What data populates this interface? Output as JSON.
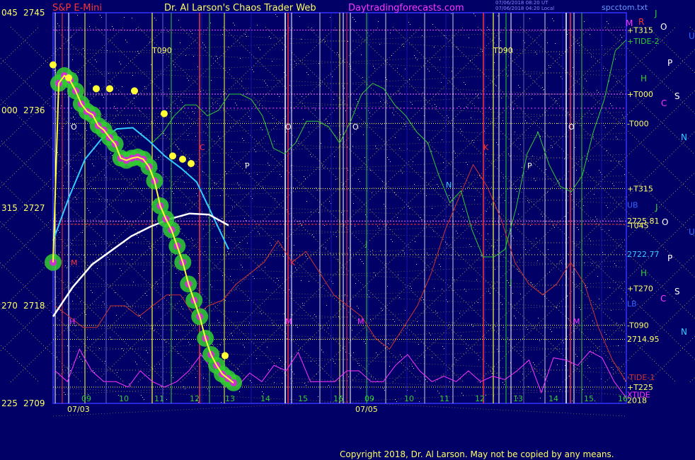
{
  "header": {
    "symbol": "S&P E-Mini",
    "title": "Dr. Al Larson's Chaos Trader Web",
    "site": "Daytradingforecasts.com",
    "timestamp_1": "07/06/2018 08:20 UT",
    "timestamp_2": "07/06/2018 04:20 Local",
    "file": "spcctom.txt"
  },
  "footer": {
    "copyright": "Copyright 2018, Dr. Al Larson. May not be copied by any means."
  },
  "colors": {
    "background": "#000066",
    "price_glow": "#33cc33",
    "price_dots": "#cc33cc",
    "price_line": "#ffff33",
    "cyan_curve": "#33ccff",
    "white_curve": "#ffffff",
    "tide2": "#33cc33",
    "tide1": "#cc3333",
    "xtide": "#ff33ff",
    "grid": "#ffff44",
    "marker_red": "#ff3333",
    "marker_green": "#33cc33"
  },
  "chart_data": {
    "type": "line",
    "y_left_labels": [
      {
        "mod": "045",
        "price": "2745"
      },
      {
        "mod": "000",
        "price": "2736"
      },
      {
        "mod": "315",
        "price": "2727"
      },
      {
        "mod": "270",
        "price": "2718"
      },
      {
        "mod": "225",
        "price": "2709"
      }
    ],
    "ylim": [
      2709,
      2745
    ],
    "x_ticks": [
      "09",
      "10",
      "11",
      "12",
      "13",
      "14",
      "15",
      "16",
      "09",
      "10",
      "11",
      "12",
      "13",
      "14",
      "15",
      "16"
    ],
    "date_labels": [
      "07/03",
      "07/05"
    ],
    "right_labels": [
      {
        "text": "+T315",
        "price": 2743.4,
        "color": "#ffff66"
      },
      {
        "text": "+TIDE-2",
        "price": 2742.4,
        "color": "#33cc33"
      },
      {
        "text": "+T000",
        "price": 2737.5,
        "color": "#ffff66"
      },
      {
        "text": "-T000",
        "price": 2734.8,
        "color": "#ffff66"
      },
      {
        "text": "+T315",
        "price": 2728.8,
        "color": "#ffff66"
      },
      {
        "text": "UB",
        "price": 2727.3,
        "color": "#3366ff"
      },
      {
        "text": "2725.81",
        "price": 2725.81,
        "color": "#ffff66"
      },
      {
        "text": "-T045",
        "price": 2725.4,
        "color": "#ffff66"
      },
      {
        "text": "2722.77",
        "price": 2722.77,
        "color": "#33ccff"
      },
      {
        "text": "+T270",
        "price": 2719.6,
        "color": "#ffff66"
      },
      {
        "text": "LB",
        "price": 2718.2,
        "color": "#3366ff"
      },
      {
        "text": "-T090",
        "price": 2716.2,
        "color": "#ffff66"
      },
      {
        "text": "2714.95",
        "price": 2714.95,
        "color": "#ffff66"
      },
      {
        "text": "-TIDE-1",
        "price": 2711.4,
        "color": "#cc3333"
      },
      {
        "text": "+T225",
        "price": 2710.5,
        "color": "#ffff66"
      },
      {
        "text": "XTIDE",
        "price": 2709.8,
        "color": "#ff33ff"
      },
      {
        "text": "2018",
        "price": 2709.3,
        "color": "#ffff66"
      }
    ],
    "planet_labels_a": [
      "J",
      "M",
      "R",
      "O",
      "U",
      "P",
      "H",
      "S",
      "C",
      "N"
    ],
    "planet_labels_b": [
      "J",
      "O",
      "U",
      "P",
      "H",
      "S",
      "C",
      "N"
    ],
    "chart_letters": [
      "T090",
      "T090",
      "O",
      "O",
      "O",
      "O",
      "P",
      "P",
      "C",
      "N",
      "J",
      "J",
      "H",
      "M",
      "M",
      "M",
      "M",
      "K",
      "K"
    ],
    "series": [
      {
        "name": "price",
        "values": [
          2722,
          2738.5,
          2739.2,
          2738.8,
          2737.8,
          2736.6,
          2735.9,
          2735.6,
          2734.6,
          2734.2,
          2733.5,
          2732.9,
          2731.6,
          2731.4,
          2731.6,
          2731.7,
          2731.5,
          2730.8,
          2729.5,
          2727.2,
          2726,
          2725,
          2723.5,
          2722,
          2720,
          2718.5,
          2717,
          2715,
          2713.5,
          2712.5,
          2711.7,
          2711.3,
          2710.9
        ]
      },
      {
        "name": "price_highs",
        "values": [
          2740.2,
          2739,
          2738,
          2738,
          2737.8,
          2735.7,
          2731.8,
          2731.5,
          2731.1,
          2713.4
        ]
      },
      {
        "name": "cyan_mean",
        "values": [
          2724,
          2728,
          2731.5,
          2733.3,
          2734.3,
          2734.4,
          2733.2,
          2731.8,
          2730.7,
          2729.4,
          2726.3,
          2723.2
        ]
      },
      {
        "name": "white_mean",
        "values": [
          2717,
          2719.7,
          2721.8,
          2723.1,
          2724.4,
          2725.3,
          2726,
          2726.5,
          2726.4,
          2725.4
        ]
      },
      {
        "name": "tide2",
        "values": [
          2733,
          2734,
          2735.5,
          2736.5,
          2736.5,
          2735.5,
          2736,
          2737.5,
          2737.5,
          2737,
          2735.5,
          2732.5,
          2732,
          2733,
          2735,
          2735,
          2734.5,
          2733,
          2735,
          2737.5,
          2738.5,
          2738,
          2736.5,
          2735.5,
          2734,
          2733,
          2730,
          2727.5,
          2728.6,
          2725,
          2722.5,
          2722.5,
          2723.2,
          2727,
          2732,
          2734,
          2731,
          2729,
          2728.5,
          2730,
          2734,
          2737,
          2741.5,
          2742.5
        ]
      },
      {
        "name": "tide1",
        "values": [
          2718,
          2717,
          2716,
          2716,
          2718,
          2718,
          2717,
          2718,
          2719,
          2719,
          2717,
          2718,
          2718.5,
          2720,
          2721,
          2722,
          2724,
          2722,
          2723,
          2721,
          2719,
          2718,
          2717,
          2715,
          2714,
          2716,
          2718,
          2721,
          2725,
          2728,
          2731,
          2729,
          2726,
          2722,
          2720,
          2719,
          2720,
          2722,
          2720,
          2716,
          2713,
          2711
        ]
      },
      {
        "name": "xtide",
        "values": [
          2712,
          2711,
          2714,
          2712,
          2711,
          2711,
          2710.5,
          2712,
          2711,
          2710.5,
          2711,
          2712,
          2713.5,
          2712,
          2711,
          2710.6,
          2711.8,
          2711,
          2712.5,
          2712,
          2713.7,
          2711,
          2711,
          2711,
          2712,
          2712,
          2711,
          2711,
          2712.5,
          2713.5,
          2712,
          2711,
          2711.5,
          2711,
          2712,
          2711,
          2711.5,
          2711.2,
          2712,
          2713,
          2710,
          2713.2,
          2713,
          2712.5,
          2713.8,
          2713.2,
          2711,
          2709.5
        ]
      }
    ]
  }
}
